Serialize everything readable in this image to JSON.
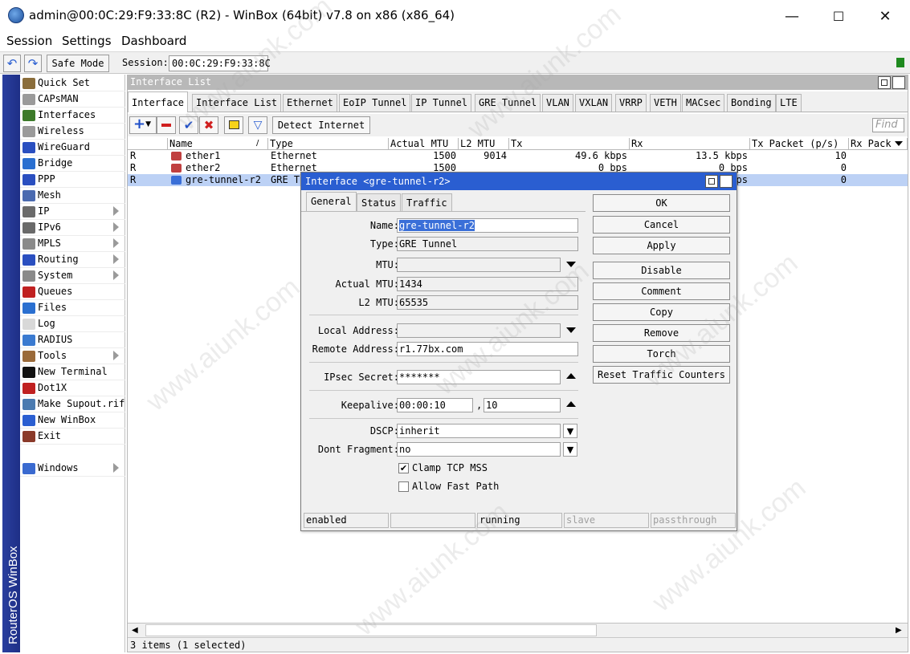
{
  "window": {
    "title": "admin@00:0C:29:F9:33:8C (R2) - WinBox (64bit) v7.8 on x86 (x86_64)",
    "minimize": "—",
    "maximize": "☐",
    "close": "✕"
  },
  "menu": [
    "Session",
    "Settings",
    "Dashboard"
  ],
  "toolbar": {
    "undo": "↶",
    "redo": "↷",
    "safe_mode": "Safe Mode",
    "session_label": "Session:",
    "session_value": "00:0C:29:F9:33:8C"
  },
  "sidebar_brand": "RouterOS WinBox",
  "sidebar": [
    {
      "label": "Quick Set",
      "icon": "wand-icon",
      "color": "#8a6d3b",
      "arrow": false
    },
    {
      "label": "CAPsMAN",
      "icon": "capsman-icon",
      "color": "#9a9a9a",
      "arrow": false
    },
    {
      "label": "Interfaces",
      "icon": "interfaces-icon",
      "color": "#3c7a2a",
      "arrow": false
    },
    {
      "label": "Wireless",
      "icon": "wireless-icon",
      "color": "#9a9a9a",
      "arrow": false
    },
    {
      "label": "WireGuard",
      "icon": "wireguard-icon",
      "color": "#2a4fc0",
      "arrow": false
    },
    {
      "label": "Bridge",
      "icon": "bridge-icon",
      "color": "#2a6fd0",
      "arrow": false
    },
    {
      "label": "PPP",
      "icon": "ppp-icon",
      "color": "#2a4fc0",
      "arrow": false
    },
    {
      "label": "Mesh",
      "icon": "mesh-icon",
      "color": "#4a6ab0",
      "arrow": false
    },
    {
      "label": "IP",
      "icon": "ip-icon",
      "color": "#6a6a6a",
      "arrow": true
    },
    {
      "label": "IPv6",
      "icon": "ipv6-icon",
      "color": "#6a6a6a",
      "arrow": true
    },
    {
      "label": "MPLS",
      "icon": "mpls-icon",
      "color": "#8a8a8a",
      "arrow": true
    },
    {
      "label": "Routing",
      "icon": "routing-icon",
      "color": "#2a4fc0",
      "arrow": true
    },
    {
      "label": "System",
      "icon": "gear-icon",
      "color": "#8a8a8a",
      "arrow": true
    },
    {
      "label": "Queues",
      "icon": "queues-icon",
      "color": "#c02020",
      "arrow": false
    },
    {
      "label": "Files",
      "icon": "folder-icon",
      "color": "#2a6fd0",
      "arrow": false
    },
    {
      "label": "Log",
      "icon": "log-icon",
      "color": "#d8d8d8",
      "arrow": false
    },
    {
      "label": "RADIUS",
      "icon": "radius-icon",
      "color": "#3a7ad0",
      "arrow": false
    },
    {
      "label": "Tools",
      "icon": "tools-icon",
      "color": "#9a6a3a",
      "arrow": true
    },
    {
      "label": "New Terminal",
      "icon": "terminal-icon",
      "color": "#111111",
      "arrow": false
    },
    {
      "label": "Dot1X",
      "icon": "dot1x-icon",
      "color": "#c02020",
      "arrow": false
    },
    {
      "label": "Make Supout.rif",
      "icon": "supout-icon",
      "color": "#4a7ab0",
      "arrow": false
    },
    {
      "label": "New WinBox",
      "icon": "winbox-icon",
      "color": "#2a5ed1",
      "arrow": false
    },
    {
      "label": "Exit",
      "icon": "exit-icon",
      "color": "#8a3a2a",
      "arrow": false
    },
    {
      "label": "Windows",
      "icon": "windows-icon",
      "color": "#3a6ad0",
      "arrow": true
    }
  ],
  "interface_list": {
    "title": "Interface List",
    "tabs": [
      "Interface",
      "Interface List",
      "Ethernet",
      "EoIP Tunnel",
      "IP Tunnel",
      "GRE Tunnel",
      "VLAN",
      "VXLAN",
      "VRRP",
      "VETH",
      "MACsec",
      "Bonding",
      "LTE"
    ],
    "detect_internet": "Detect Internet",
    "find_placeholder": "Find",
    "columns": [
      "",
      "Name",
      "Type",
      "Actual MTU",
      "L2 MTU",
      "Tx",
      "Rx",
      "Tx Packet (p/s)",
      "Rx Pack"
    ],
    "rows": [
      {
        "flag": "R",
        "name": "ether1",
        "type": "Ethernet",
        "actual_mtu": "1500",
        "l2_mtu": "9014",
        "tx": "49.6 kbps",
        "rx": "13.5 kbps",
        "tx_packet": "10",
        "selected": false
      },
      {
        "flag": "R",
        "name": "ether2",
        "type": "Ethernet",
        "actual_mtu": "1500",
        "l2_mtu": "",
        "tx": "0 bps",
        "rx": "0 bps",
        "tx_packet": "0",
        "selected": false
      },
      {
        "flag": "R",
        "name": "gre-tunnel-r2",
        "type": "GRE Tu",
        "actual_mtu": "",
        "l2_mtu": "",
        "tx": "",
        "rx": "ps",
        "tx_packet": "0",
        "selected": true
      }
    ],
    "status": "3 items (1 selected)"
  },
  "dialog": {
    "title": "Interface <gre-tunnel-r2>",
    "tabs": [
      "General",
      "Status",
      "Traffic"
    ],
    "fields": {
      "name_label": "Name:",
      "name_value": "gre-tunnel-r2",
      "type_label": "Type:",
      "type_value": "GRE Tunnel",
      "mtu_label": "MTU:",
      "mtu_value": "",
      "actual_mtu_label": "Actual MTU:",
      "actual_mtu_value": "1434",
      "l2_mtu_label": "L2 MTU:",
      "l2_mtu_value": "65535",
      "local_address_label": "Local Address:",
      "local_address_value": "",
      "remote_address_label": "Remote Address:",
      "remote_address_value": "r1.77bx.com",
      "ipsec_secret_label": "IPsec Secret:",
      "ipsec_secret_value": "*******",
      "keepalive_label": "Keepalive:",
      "keepalive_interval": "00:00:10",
      "keepalive_sep": ",",
      "keepalive_retries": "10",
      "dscp_label": "DSCP:",
      "dscp_value": "inherit",
      "dont_fragment_label": "Dont Fragment:",
      "dont_fragment_value": "no",
      "clamp_tcp_mss_label": "Clamp TCP MSS",
      "clamp_tcp_mss_checked": true,
      "allow_fast_path_label": "Allow Fast Path",
      "allow_fast_path_checked": false
    },
    "buttons": [
      "OK",
      "Cancel",
      "Apply",
      "Disable",
      "Comment",
      "Copy",
      "Remove",
      "Torch",
      "Reset Traffic Counters"
    ],
    "status": [
      "enabled",
      "",
      "running",
      "slave",
      "passthrough"
    ]
  },
  "watermark": "www.aiunk.com",
  "colors": {
    "selection": "#bcd1f5",
    "dialog_title": "#2a5ed1",
    "sidebar_band": "#23359a"
  }
}
